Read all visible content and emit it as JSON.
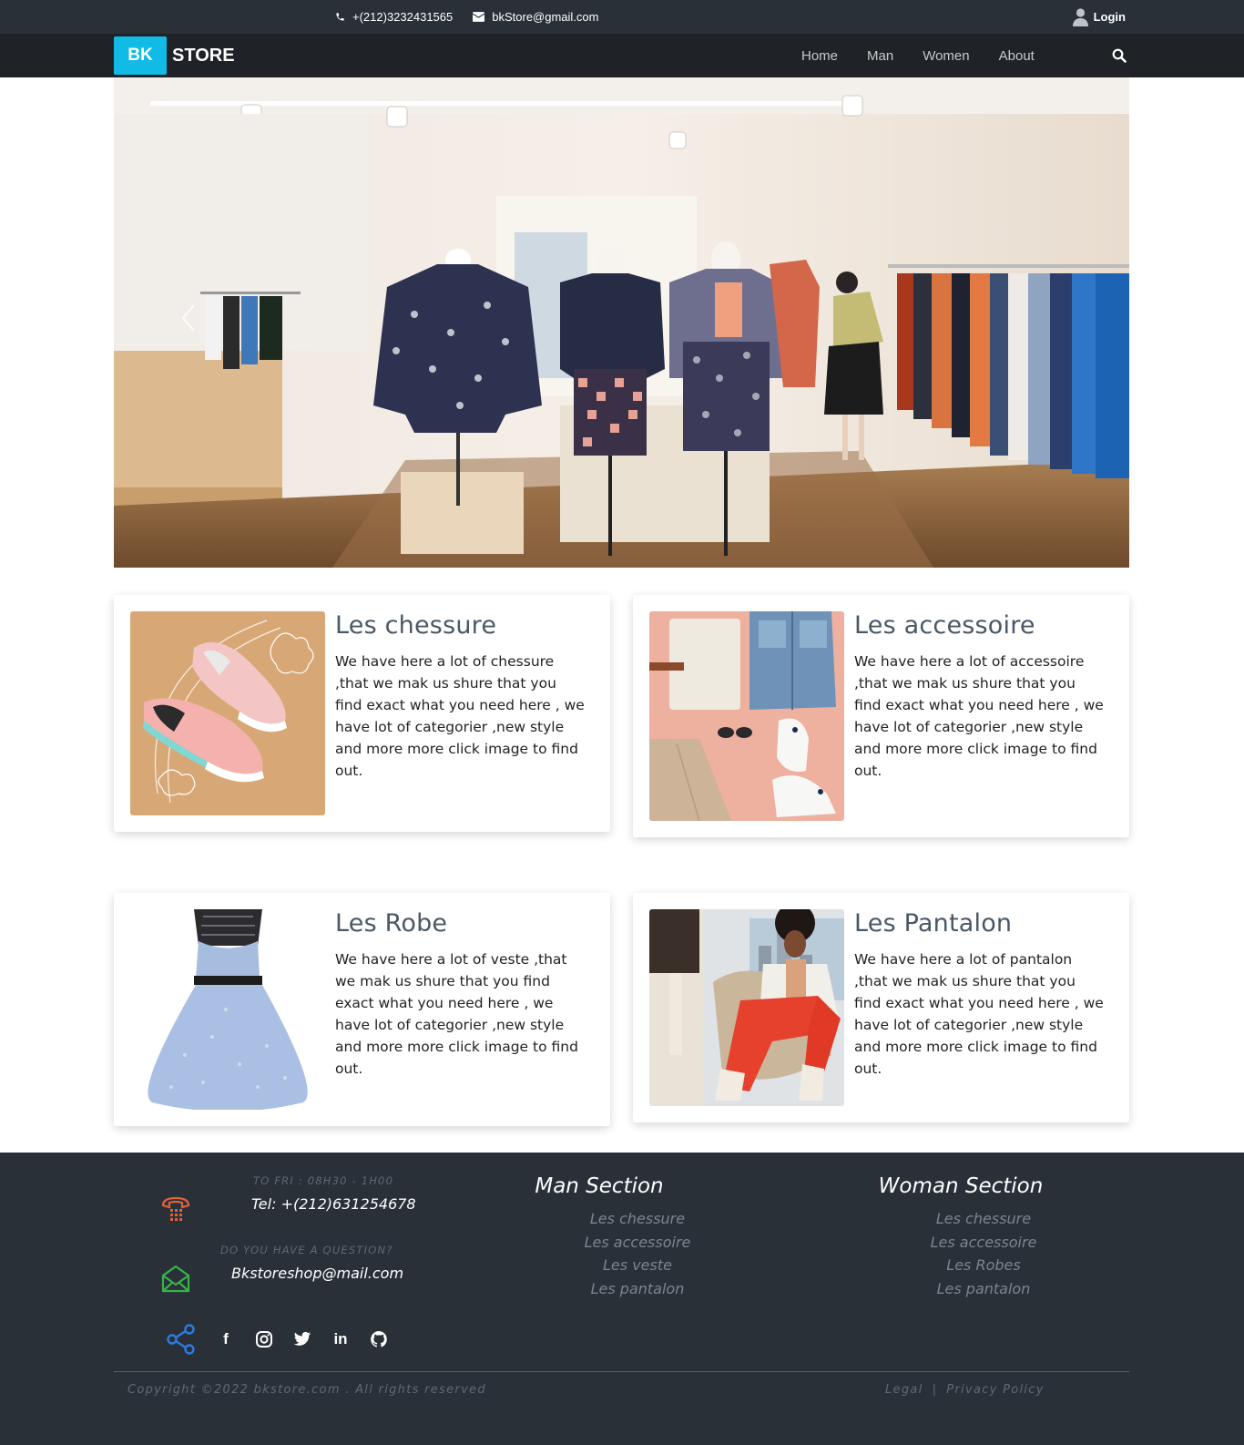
{
  "topbar": {
    "phone": "+(212)3232431565",
    "email": "bkStore@gmail.com",
    "login_label": "Login"
  },
  "brand": {
    "badge": "BK",
    "name": "STORE"
  },
  "nav": {
    "items": [
      "Home",
      "Man",
      "Women",
      "About"
    ]
  },
  "cards": [
    {
      "title": "Les chessure",
      "description": "We have here a lot of chessure ,that we mak us shure that you find exact what you need here , we have lot of categorier ,new style and more more click image to find out."
    },
    {
      "title": "Les accessoire",
      "description": "We have here a lot of accessoire ,that we mak us shure that you find exact what you need here , we have lot of categorier ,new style and more more click image to find out."
    },
    {
      "title": "Les Robe",
      "description": "We have here a lot of veste ,that we mak us shure that you find exact what you need here , we have lot of categorier ,new style and more more click image to find out."
    },
    {
      "title": "Les Pantalon",
      "description": "We have here a lot of pantalon ,that we mak us shure that you find exact what you need here , we have lot of categorier ,new style and more more click image to find out."
    }
  ],
  "footer": {
    "hours_caption": "TO FRI : 08H30 - 1H00",
    "tel": "Tel: +(212)631254678",
    "question_caption": "DO YOU HAVE A QUESTION?",
    "email": "Bkstoreshop@mail.com",
    "man_section": {
      "title": "Man Section",
      "links": [
        "Les chessure",
        "Les accessoire",
        "Les veste",
        "Les pantalon"
      ]
    },
    "woman_section": {
      "title": "Woman Section",
      "links": [
        "Les chessure",
        "Les accessoire",
        "Les Robes",
        "Les pantalon"
      ]
    },
    "social_icons": [
      "share-icon",
      "facebook-icon",
      "instagram-icon",
      "twitter-icon",
      "linkedin-icon",
      "github-icon"
    ],
    "copyright": "Copyright ©2022 bkstore.com . All rights reserved",
    "legal": "Legal",
    "legal_separator": "|",
    "privacy": "Privacy Policy"
  },
  "colors": {
    "topbar_bg": "#293038",
    "navbar_bg": "#1f2328",
    "brand_accent": "#12bbe6",
    "phone_icon": "#e0623a",
    "mail_icon": "#37b34a",
    "share_icon": "#2e7be0"
  }
}
